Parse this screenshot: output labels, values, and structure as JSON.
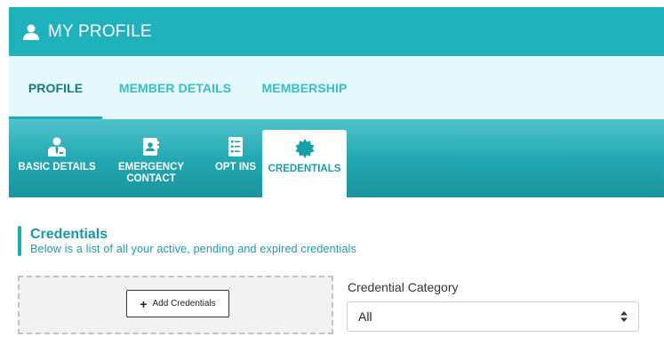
{
  "header": {
    "title": "MY PROFILE",
    "icon": "user-icon"
  },
  "main_tabs": [
    {
      "label": "PROFILE",
      "active": true
    },
    {
      "label": "MEMBER DETAILS",
      "active": false
    },
    {
      "label": "MEMBERSHIP",
      "active": false
    }
  ],
  "sub_tabs": [
    {
      "label": "BASIC DETAILS",
      "icon": "person-tie-icon",
      "active": false
    },
    {
      "label": "EMERGENCY\nCONTACT",
      "icon": "contact-card-icon",
      "active": false
    },
    {
      "label": "OPT INS",
      "icon": "checklist-icon",
      "active": false
    },
    {
      "label": "CREDENTIALS",
      "icon": "badge-seal-icon",
      "active": true
    }
  ],
  "credentials": {
    "title": "Credentials",
    "subtitle": "Below is a list of all your active, pending and expired credentials",
    "add_button_label": "Add Credentials",
    "category_label": "Credential Category",
    "category_selected": "All"
  },
  "colors": {
    "header": "#1fb2bd",
    "tabs_bg": "#e5f8fb",
    "accent": "#1eaab4"
  }
}
